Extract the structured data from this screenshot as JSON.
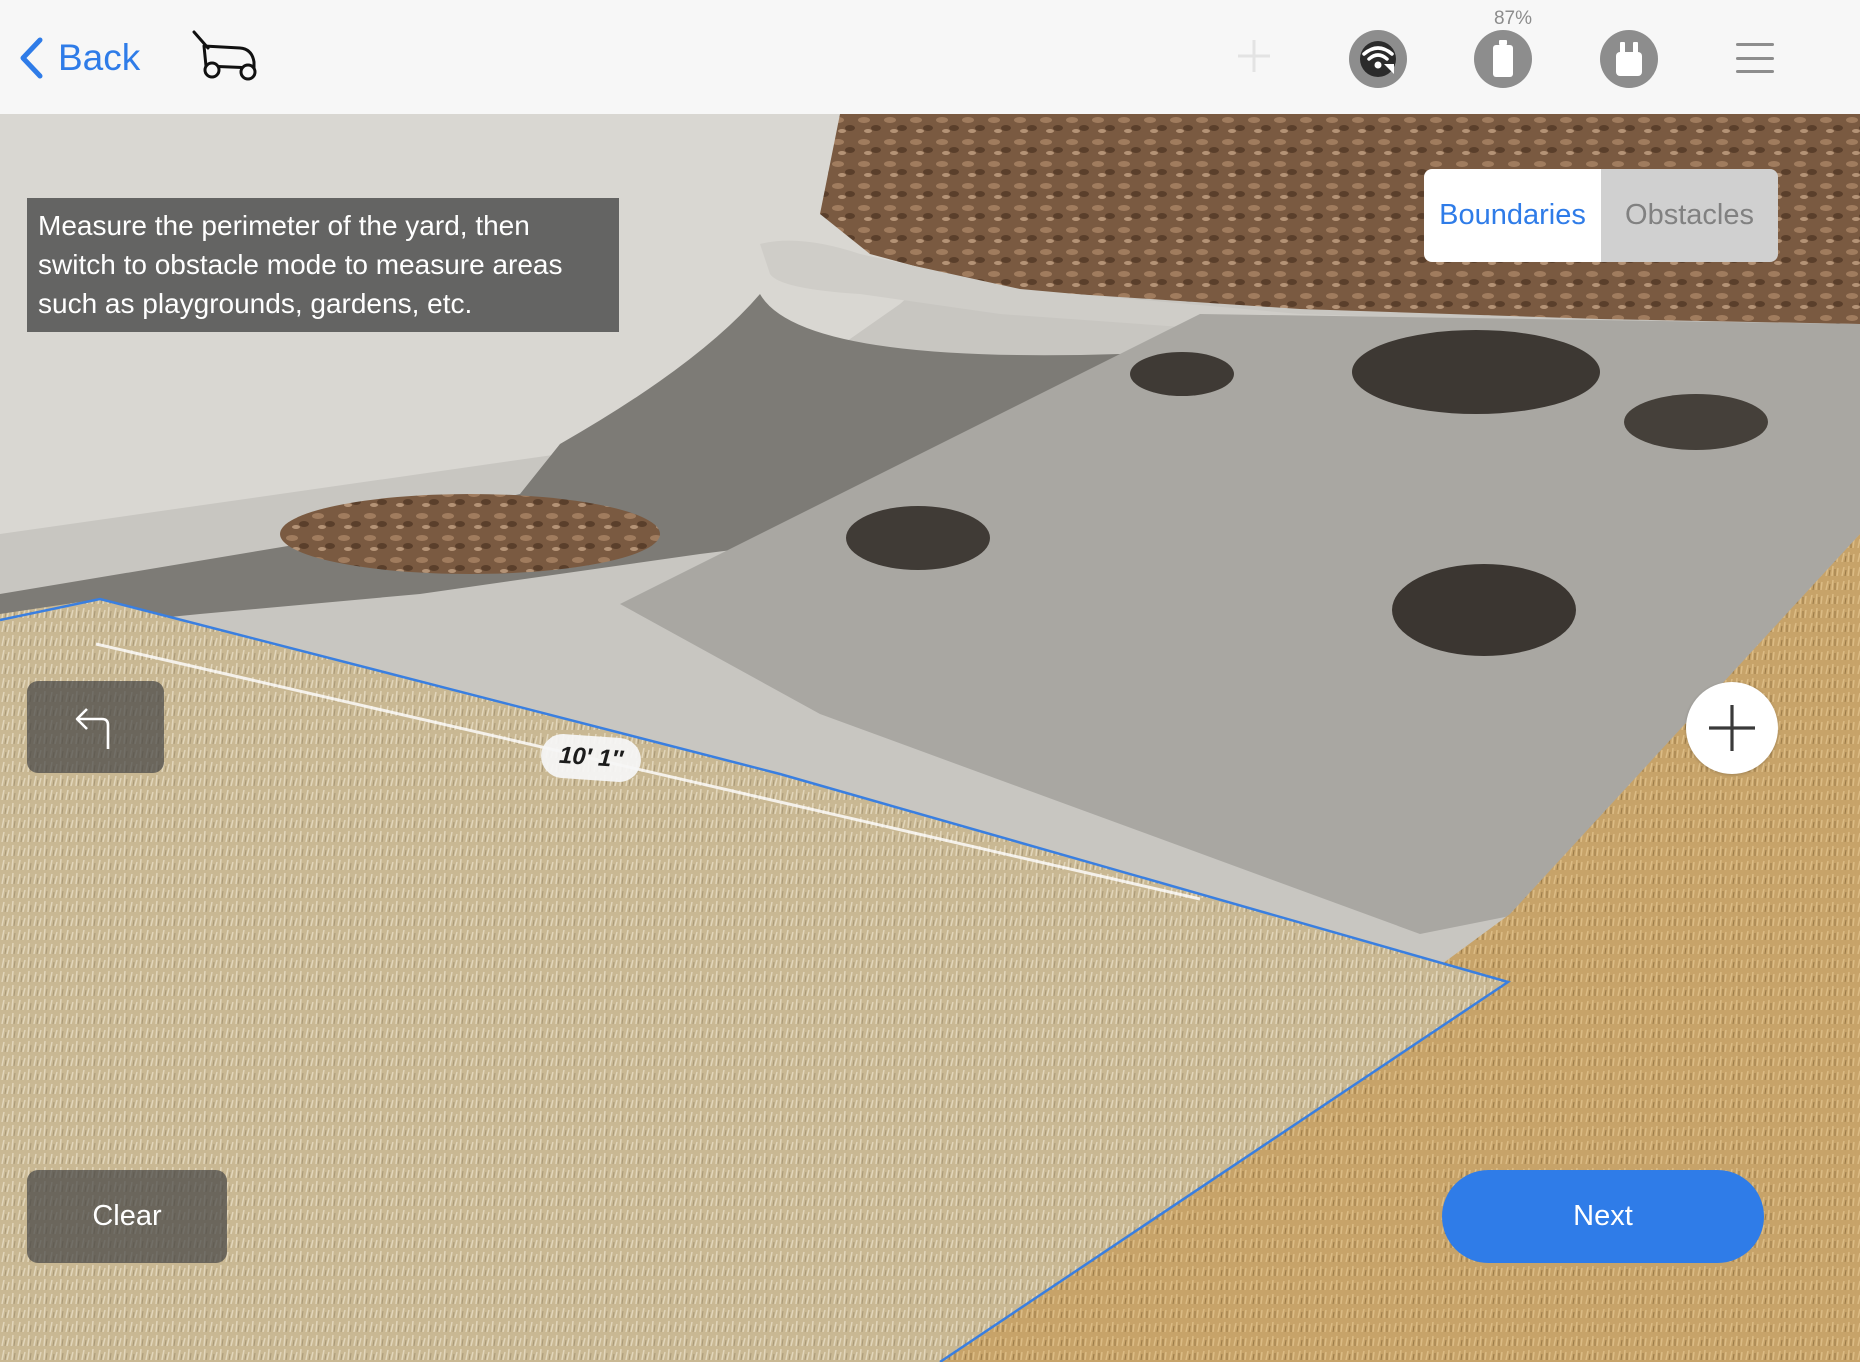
{
  "header": {
    "back_label": "Back",
    "battery_percent": "87%",
    "icons": [
      "chevron-left-icon",
      "lawn-mower-icon",
      "plus-icon",
      "signal-icon",
      "battery-icon",
      "bag-icon",
      "menu-icon"
    ]
  },
  "instruction": {
    "text": "Measure the perimeter of the yard, then switch to obstacle mode to measure areas such as playgrounds, gardens, etc."
  },
  "mode_toggle": {
    "selected": "Boundaries",
    "options": [
      "Boundaries",
      "Obstacles"
    ]
  },
  "measurement": {
    "label": "10′ 1″"
  },
  "actions": {
    "clear_label": "Clear",
    "next_label": "Next"
  },
  "colors": {
    "accent": "#2f7ce8",
    "boundary_line": "#3a7fe0",
    "bar_background": "#f7f7f7",
    "icon_gray": "#8d8d8d"
  }
}
